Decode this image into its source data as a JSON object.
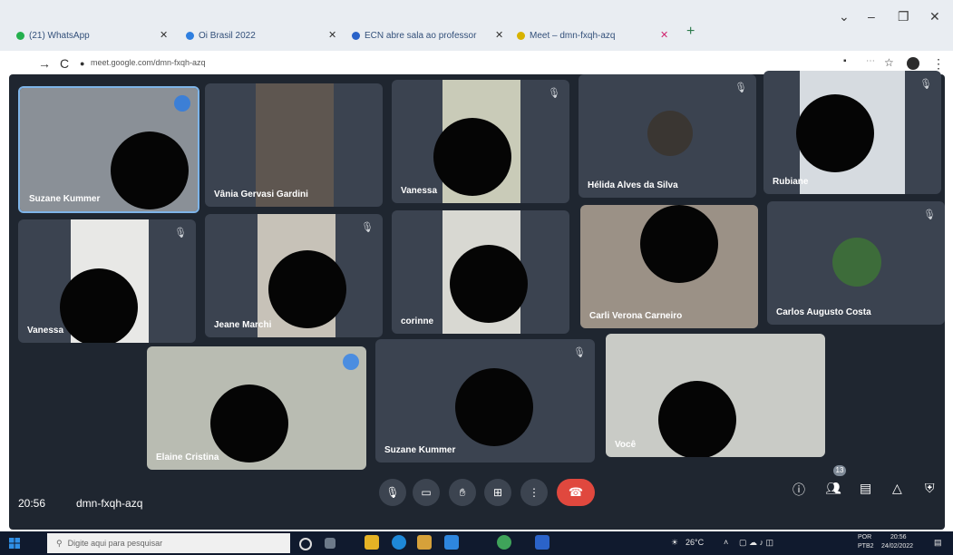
{
  "browser": {
    "tabs": [
      {
        "label": "(21) WhatsApp",
        "color": "#25b04e"
      },
      {
        "label": "Oi Brasil 2022",
        "color": "#2f7fe0"
      },
      {
        "label": "ECN abre sala ao professor",
        "color": "#2a63c9"
      },
      {
        "label": "Meet – dmn-fxqh-azq",
        "color": "#d8b300"
      }
    ],
    "new_tab": "+",
    "url": "meet.google.com/dmn-fxqh-azq",
    "window_controls": {
      "minimize": "–",
      "maximize": "❐",
      "close": "✕",
      "chevron": "⌄"
    }
  },
  "meet": {
    "participants": [
      {
        "name": "Suzane Kummer"
      },
      {
        "name": "Vânia Gervasi Gardini"
      },
      {
        "name": "Vanessa"
      },
      {
        "name": "Hélida Alves da Silva"
      },
      {
        "name": "Rubiane"
      },
      {
        "name": "Vanessa"
      },
      {
        "name": "Jeane Marchi"
      },
      {
        "name": "corinne"
      },
      {
        "name": "Carli Verona Carneiro"
      },
      {
        "name": "Carlos Augusto Costa"
      },
      {
        "name": "Elaine Cristina"
      },
      {
        "name": "Suzane Kummer"
      },
      {
        "name": "Você"
      }
    ],
    "clock": "20:56",
    "meeting_code": "dmn-fxqh-azq",
    "people_count": "13"
  },
  "taskbar": {
    "search_placeholder": "Digite aqui para pesquisar",
    "weather": "26°C",
    "language": "POR",
    "region": "PTB2",
    "time": "20:56",
    "date": "24/02/2022"
  }
}
